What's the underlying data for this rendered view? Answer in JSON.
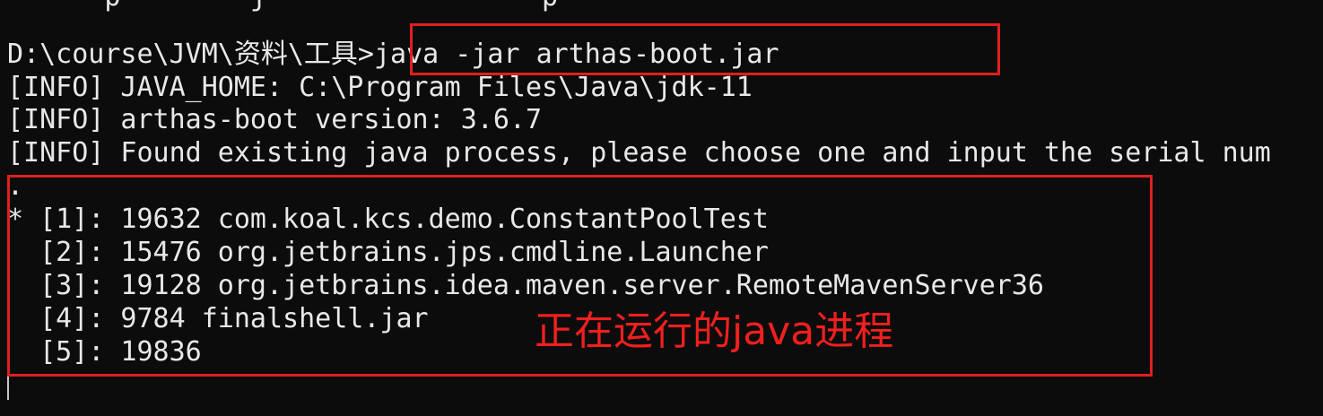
{
  "terminal": {
    "partial_top_line": "      p        j                 p",
    "prompt": "D:\\course\\JVM\\资料\\工具>",
    "command": "java -jar arthas-boot.jar",
    "info_lines": [
      "[INFO] JAVA_HOME: C:\\Program Files\\Java\\jdk-11",
      "[INFO] arthas-boot version: 3.6.7",
      "[INFO] Found existing java process, please choose one and input the serial num"
    ],
    "dot_line": ".",
    "processes": [
      "* [1]: 19632 com.koal.kcs.demo.ConstantPoolTest",
      "  [2]: 15476 org.jetbrains.jps.cmdline.Launcher",
      "  [3]: 19128 org.jetbrains.idea.maven.server.RemoteMavenServer36",
      "  [4]: 9784 finalshell.jar",
      "  [5]: 19836"
    ]
  },
  "annotation": {
    "text": "正在运行的java进程",
    "color": "#e0201e"
  }
}
